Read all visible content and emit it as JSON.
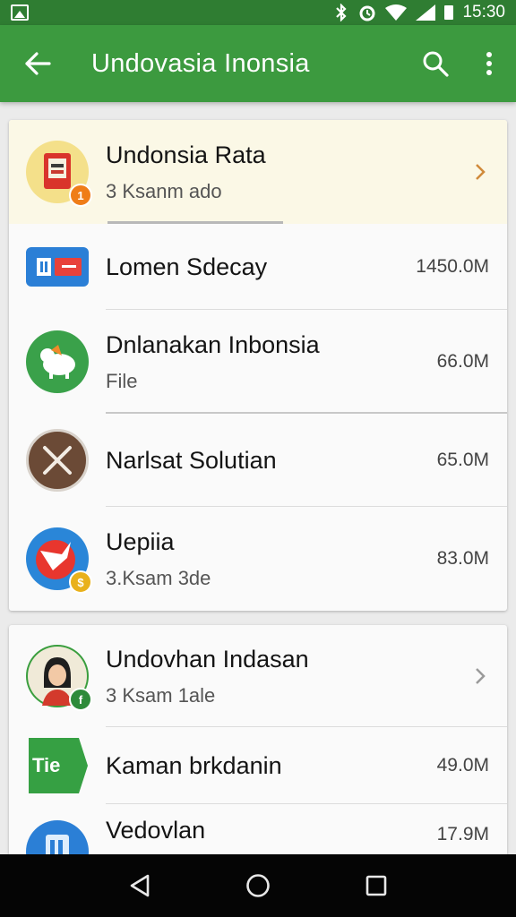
{
  "status_bar": {
    "time": "15:30"
  },
  "app_bar": {
    "title": "Undovasia Inonsia"
  },
  "colors": {
    "app_bar": "#3c9a3f",
    "status_bar": "#2f7d32",
    "highlight_row": "#fbf8e6"
  },
  "card1": {
    "items": [
      {
        "name": "Undonsia Rata",
        "sub": "3 Ksanm ado",
        "badge": "1",
        "icon": "book-app-icon"
      },
      {
        "name": "Lomen Sdecay",
        "size": "1450.0M",
        "icon": "flag-app-icon"
      },
      {
        "name": "Dnlanakan Inbonsia",
        "sub": "File",
        "size": "66.0M",
        "icon": "animal-app-icon"
      },
      {
        "name": "Narlsat Solutian",
        "size": "65.0M",
        "icon": "cross-app-icon"
      },
      {
        "name": "Uepiia",
        "sub": "3.Ksam 3de",
        "size": "83.0M",
        "icon": "bird-app-icon"
      }
    ]
  },
  "card2": {
    "items": [
      {
        "name": "Undovhan Indasan",
        "sub": "3 Ksam 1ale",
        "icon": "person-app-icon"
      },
      {
        "name": "Kaman brkdanin",
        "size": "49.0M",
        "icon_text": "Tie",
        "icon": "tag-app-icon"
      },
      {
        "name": "Vedovlan",
        "size": "17.9M",
        "icon": "blue-app-icon"
      }
    ]
  }
}
